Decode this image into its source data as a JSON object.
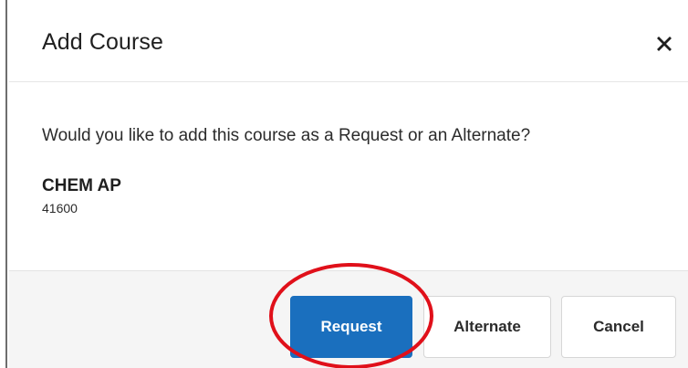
{
  "dialog": {
    "title": "Add Course",
    "close_icon": "close-icon",
    "question": "Would you like to add this course as a Request or an Alternate?",
    "course": {
      "name": "CHEM AP",
      "number": "41600"
    }
  },
  "footer": {
    "request_label": "Request",
    "alternate_label": "Alternate",
    "cancel_label": "Cancel"
  },
  "colors": {
    "primary": "#1a6fbe",
    "highlight": "#e0101a",
    "footer_bg": "#f5f5f5"
  }
}
